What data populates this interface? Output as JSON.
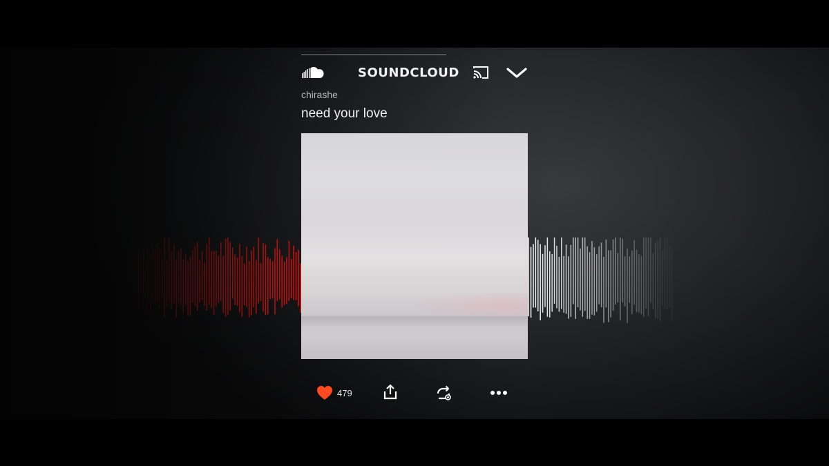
{
  "app": {
    "brand": "SOUNDCLOUD"
  },
  "header": {
    "icons": [
      "soundcloud-cloud-icon",
      "cast-icon",
      "chevron-down-icon"
    ]
  },
  "track": {
    "artist": "chirashe",
    "title": "need your love"
  },
  "playback": {
    "progress_fraction": 0.5
  },
  "actions": {
    "like_count": "479",
    "icons": [
      "heart-icon",
      "share-icon",
      "repost-icon",
      "more-icon"
    ]
  },
  "colors": {
    "played": "#ff5a1f",
    "played_deep": "#e0120c",
    "unplayed": "#ffffff",
    "like": "#ff4b1f",
    "background": "#1c1d1f"
  }
}
